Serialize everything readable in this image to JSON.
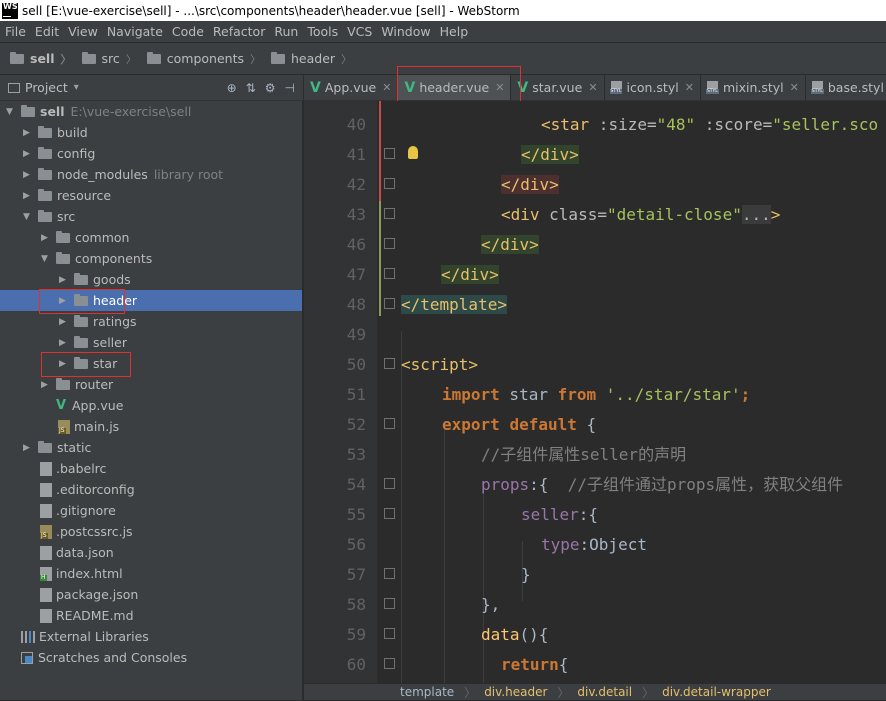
{
  "window": {
    "logo_text": "WS",
    "title": "sell [E:\\vue-exercise\\sell] - ...\\src\\components\\header\\header.vue [sell] - WebStorm"
  },
  "menu": [
    "File",
    "Edit",
    "View",
    "Navigate",
    "Code",
    "Refactor",
    "Run",
    "Tools",
    "VCS",
    "Window",
    "Help"
  ],
  "breadcrumb": [
    "sell",
    "src",
    "components",
    "header"
  ],
  "project_panel": {
    "title": "Project",
    "dropdown": "▾",
    "tools": [
      "⊕",
      "⇅",
      "⚙",
      "⊣"
    ]
  },
  "tree": [
    {
      "label": "sell",
      "hint": "E:\\vue-exercise\\sell",
      "type": "folder",
      "expanded": true
    },
    {
      "label": "build",
      "type": "folder"
    },
    {
      "label": "config",
      "type": "folder"
    },
    {
      "label": "node_modules",
      "hint": "library root",
      "type": "folder"
    },
    {
      "label": "resource",
      "type": "folder"
    },
    {
      "label": "src",
      "type": "folder",
      "expanded": true
    },
    {
      "label": "common",
      "type": "folder"
    },
    {
      "label": "components",
      "type": "folder",
      "expanded": true
    },
    {
      "label": "goods",
      "type": "folder"
    },
    {
      "label": "header",
      "type": "folder",
      "selected": true
    },
    {
      "label": "ratings",
      "type": "folder"
    },
    {
      "label": "seller",
      "type": "folder"
    },
    {
      "label": "star",
      "type": "folder"
    },
    {
      "label": "router",
      "type": "folder"
    },
    {
      "label": "App.vue",
      "type": "vue"
    },
    {
      "label": "main.js",
      "type": "js"
    },
    {
      "label": "static",
      "type": "folder"
    },
    {
      "label": ".babelrc",
      "type": "file"
    },
    {
      "label": ".editorconfig",
      "type": "file"
    },
    {
      "label": ".gitignore",
      "type": "file"
    },
    {
      "label": ".postcssrc.js",
      "type": "js"
    },
    {
      "label": "data.json",
      "type": "file"
    },
    {
      "label": "index.html",
      "type": "html"
    },
    {
      "label": "package.json",
      "type": "file"
    },
    {
      "label": "README.md",
      "type": "file"
    },
    {
      "label": "External Libraries",
      "type": "lib"
    },
    {
      "label": "Scratches and Consoles",
      "type": "scratch"
    }
  ],
  "tabs": [
    {
      "label": "App.vue",
      "icon": "vue"
    },
    {
      "label": "header.vue",
      "icon": "vue",
      "active": true
    },
    {
      "label": "star.vue",
      "icon": "vue"
    },
    {
      "label": "icon.styl",
      "icon": "styl"
    },
    {
      "label": "mixin.styl",
      "icon": "styl"
    },
    {
      "label": "base.styl",
      "icon": "styl"
    }
  ],
  "code": {
    "ln": [
      "40",
      "41",
      "42",
      "43",
      "46",
      "47",
      "48",
      "49",
      "50",
      "51",
      "52",
      "53",
      "54",
      "55",
      "56",
      "57",
      "58",
      "59",
      "60"
    ],
    "l40": {
      "open": "<star",
      "a1": " :size=",
      "v1": "\"48\"",
      "a2": " :score=",
      "v2": "\"seller.sco"
    },
    "l41": "</div>",
    "l42": "</div>",
    "l43": {
      "open": "<div",
      "a1": " class=",
      "v1": "\"detail-close\"",
      "dots": "...",
      "close": ">"
    },
    "l46": "</div>",
    "l47": "</div>",
    "l48": "</template>",
    "l50": "<script>",
    "l51": {
      "kw1": "import",
      "id": " star ",
      "kw2": "from",
      "sp": " ",
      "str": "'../star/star'",
      "semi": ";"
    },
    "l52": {
      "kw1": "export",
      "sp": " ",
      "kw2": "default",
      "rest": " {"
    },
    "l53": "//子组件属性seller的声明",
    "l54": {
      "prop": "props",
      "rest": ":{  ",
      "cm": "//子组件通过props属性，获取父组件"
    },
    "l55": {
      "prop": "seller",
      "rest": ":{"
    },
    "l56": {
      "prop": "type",
      "rest": ":Object"
    },
    "l57": "}",
    "l58": "},",
    "l59": {
      "fn": "data",
      "rest": "(){"
    },
    "l60": {
      "kw": "return",
      "rest": "{"
    }
  },
  "status_breadcrumb": [
    "template",
    "div.header",
    "div.detail",
    "div.detail-wrapper"
  ]
}
